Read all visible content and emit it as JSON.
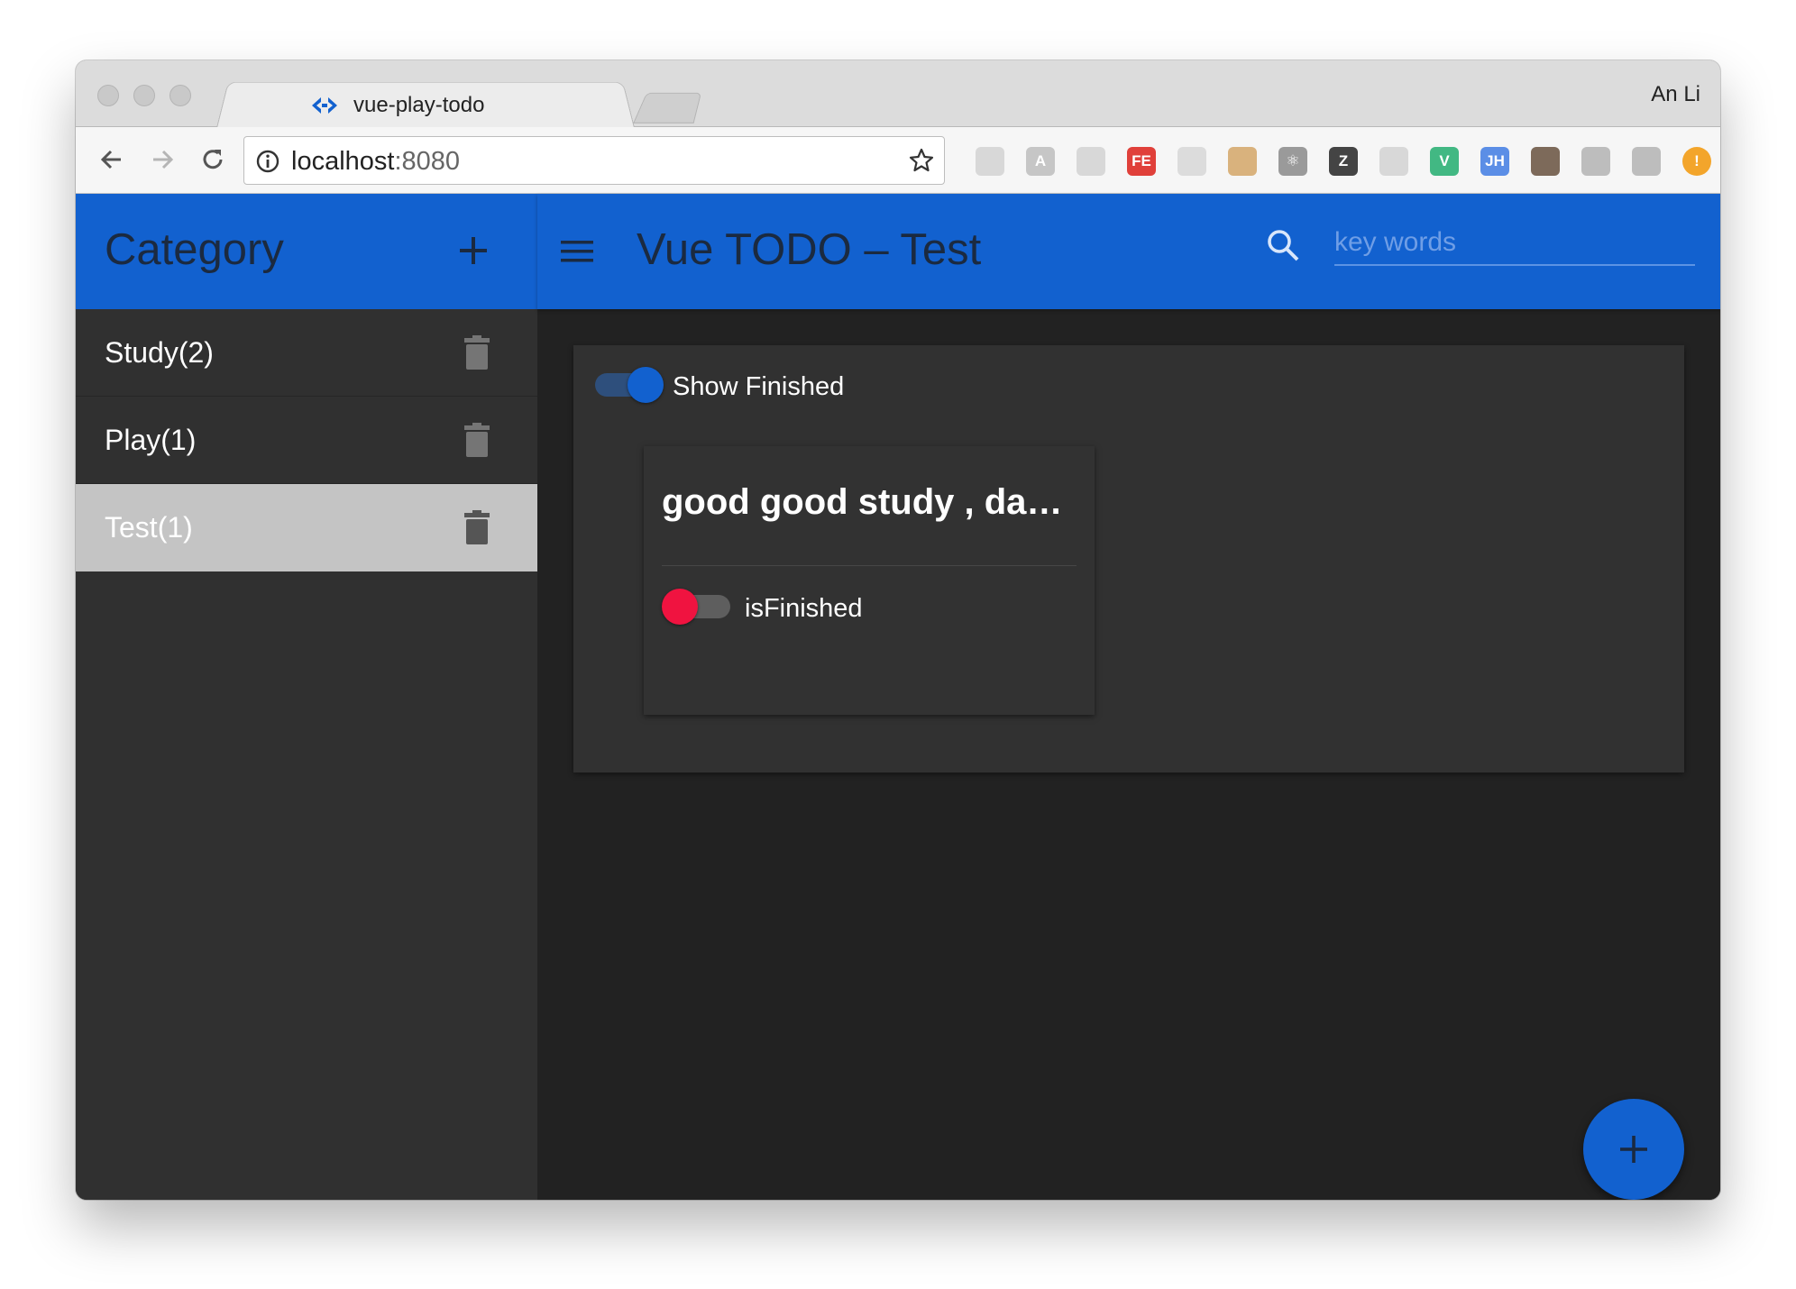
{
  "browser": {
    "tab_title": "vue-play-todo",
    "tab_close": "×",
    "profile_name": "An Li",
    "url_host": "localhost",
    "url_port": ":8080",
    "extensions": [
      {
        "name": "chrome-ext-icon",
        "glyph": "",
        "color": "#d8d8d8"
      },
      {
        "name": "angular-ext-icon",
        "glyph": "A",
        "color": "#c6c6c6"
      },
      {
        "name": "target-ext-icon",
        "glyph": "",
        "color": "#d8d8d8"
      },
      {
        "name": "fe-ext-icon",
        "glyph": "FE",
        "color": "#e0403a"
      },
      {
        "name": "window-ext-icon",
        "glyph": "",
        "color": "#dcdcdc"
      },
      {
        "name": "signpost-ext-icon",
        "glyph": "",
        "color": "#d9b27d"
      },
      {
        "name": "react-ext-icon",
        "glyph": "⚛",
        "color": "#9a9a9a"
      },
      {
        "name": "z-ext-icon",
        "glyph": "Z",
        "color": "#444444"
      },
      {
        "name": "target2-ext-icon",
        "glyph": "",
        "color": "#d8d8d8"
      },
      {
        "name": "vue-ext-icon",
        "glyph": "V",
        "color": "#42b883"
      },
      {
        "name": "jh-ext-icon",
        "glyph": "JH",
        "color": "#5b8ee6"
      },
      {
        "name": "camera-ext-icon",
        "glyph": "",
        "color": "#7d6a5a"
      },
      {
        "name": "pen-ext-icon",
        "glyph": "",
        "color": "#bdbdbd"
      },
      {
        "name": "square-ext-icon",
        "glyph": "",
        "color": "#bdbdbd"
      },
      {
        "name": "alert-ext-icon",
        "glyph": "!",
        "color": "#f3a52b"
      }
    ]
  },
  "sidebar": {
    "title": "Category",
    "categories": [
      {
        "label": "Study(2)",
        "active": false
      },
      {
        "label": "Play(1)",
        "active": false
      },
      {
        "label": "Test(1)",
        "active": true
      }
    ]
  },
  "header": {
    "title": "Vue TODO – Test",
    "search_placeholder": "key words"
  },
  "panel": {
    "show_finished_label": "Show Finished",
    "show_finished": true
  },
  "todos": [
    {
      "title": "good good study , day day up",
      "finished_label": "isFinished",
      "finished": false
    }
  ],
  "colors": {
    "primary": "#1261cf",
    "accent": "#f01340",
    "sidebar_bg": "#303030",
    "main_bg": "#222222"
  }
}
